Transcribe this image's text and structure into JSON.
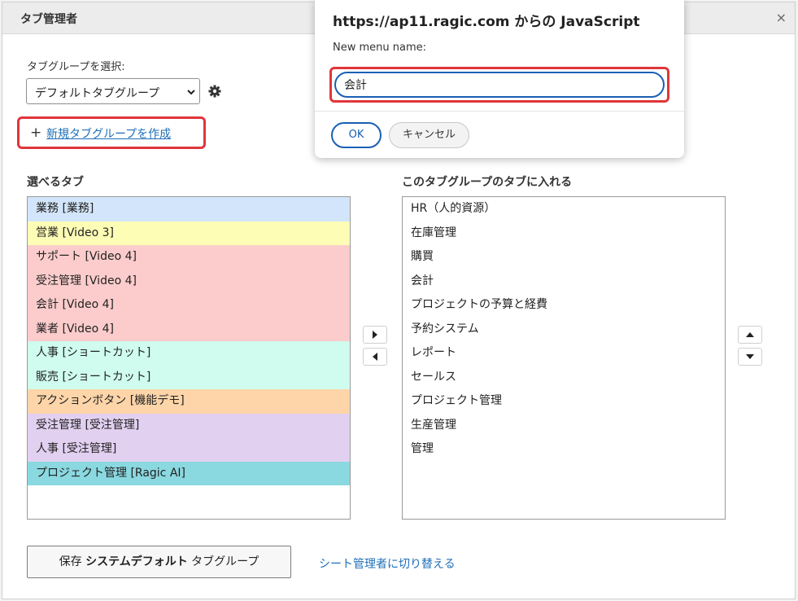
{
  "dialog": {
    "title": "タブ管理者",
    "close_symbol": "×",
    "select_label": "タブグループを選択:",
    "selected_group": "デフォルトタブグループ",
    "create_link_plus": "+",
    "create_link": "新規タブグループを作成",
    "available_title": "選べるタブ",
    "included_title": "このタブグループのタブに入れる",
    "save_prefix": "保存",
    "save_bold": "システムデフォルト",
    "save_suffix": "タブグループ",
    "switch_link": "シート管理者に切り替える"
  },
  "available_tabs": [
    {
      "label": "業務 [業務]",
      "color": "#d3e5fa"
    },
    {
      "label": "営業 [Video 3]",
      "color": "#fefdb6"
    },
    {
      "label": "サポート [Video 4]",
      "color": "#fccccc"
    },
    {
      "label": "受注管理 [Video 4]",
      "color": "#fccccc"
    },
    {
      "label": "会計 [Video 4]",
      "color": "#fccccc"
    },
    {
      "label": "業者 [Video 4]",
      "color": "#fccccc"
    },
    {
      "label": "人事 [ショートカット]",
      "color": "#cffcee"
    },
    {
      "label": "販売 [ショートカット]",
      "color": "#cffcee"
    },
    {
      "label": "アクションボタン [機能デモ]",
      "color": "#fed5a9"
    },
    {
      "label": "受注管理 [受注管理]",
      "color": "#e2d0f1"
    },
    {
      "label": "人事 [受注管理]",
      "color": "#e2d0f1"
    },
    {
      "label": "プロジェクト管理 [Ragic AI]",
      "color": "#8ad8e0"
    }
  ],
  "included_tabs": [
    "HR（人的資源）",
    "在庫管理",
    "購買",
    "会計",
    "プロジェクトの予算と経費",
    "予約システム",
    "レポート",
    "セールス",
    "プロジェクト管理",
    "生産管理",
    "管理"
  ],
  "prompt": {
    "title": "https://ap11.ragic.com からの JavaScript",
    "message": "New menu name:",
    "input_value": "会計",
    "ok_label": "OK",
    "cancel_label": "キャンセル"
  },
  "colors": {
    "highlight_red": "#e0363b",
    "link_blue": "#1e6fb8",
    "focus_blue": "#1a5fb4"
  },
  "icons": [
    "close-icon",
    "chevron-down-icon",
    "gear-icon",
    "arrow-right-icon",
    "arrow-left-icon",
    "arrow-up-icon",
    "arrow-down-icon"
  ]
}
